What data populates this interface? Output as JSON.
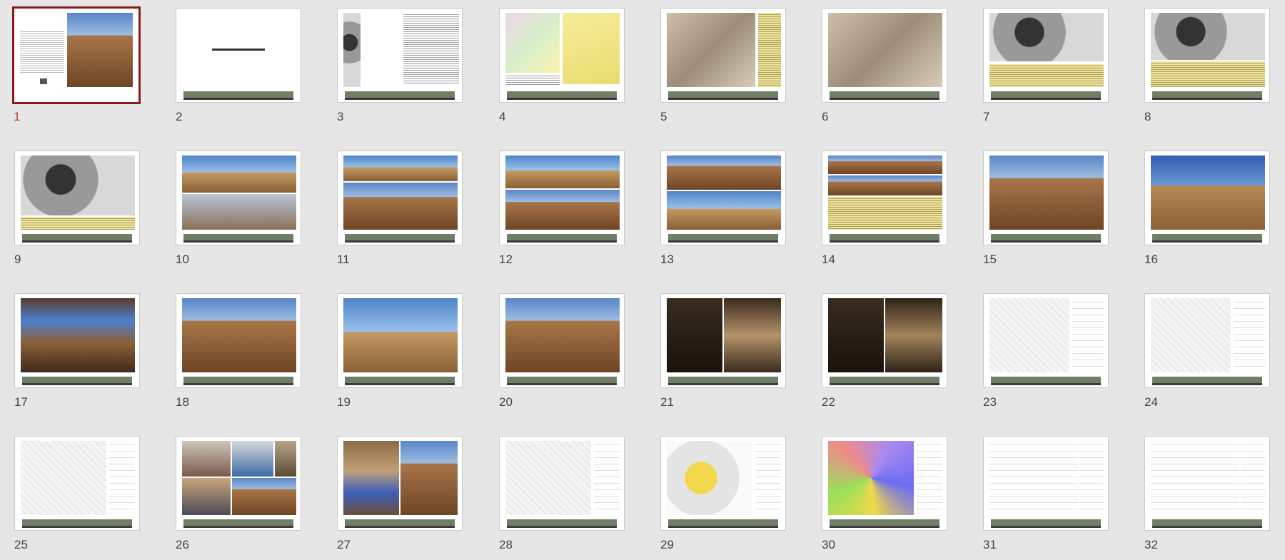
{
  "slides": [
    {
      "number": "1"
    },
    {
      "number": "2"
    },
    {
      "number": "3"
    },
    {
      "number": "4"
    },
    {
      "number": "5"
    },
    {
      "number": "6"
    },
    {
      "number": "7"
    },
    {
      "number": "8"
    },
    {
      "number": "9"
    },
    {
      "number": "10"
    },
    {
      "number": "11"
    },
    {
      "number": "12"
    },
    {
      "number": "13"
    },
    {
      "number": "14"
    },
    {
      "number": "15"
    },
    {
      "number": "16"
    },
    {
      "number": "17"
    },
    {
      "number": "18"
    },
    {
      "number": "19"
    },
    {
      "number": "20"
    },
    {
      "number": "21"
    },
    {
      "number": "22"
    },
    {
      "number": "23"
    },
    {
      "number": "24"
    },
    {
      "number": "25"
    },
    {
      "number": "26"
    },
    {
      "number": "27"
    },
    {
      "number": "28"
    },
    {
      "number": "29"
    },
    {
      "number": "30"
    },
    {
      "number": "31"
    },
    {
      "number": "32"
    }
  ],
  "selected_slide": "1",
  "colors": {
    "selected_border": "#8b1a1a",
    "selected_number": "#c0392b",
    "background": "#e6e6e6"
  }
}
